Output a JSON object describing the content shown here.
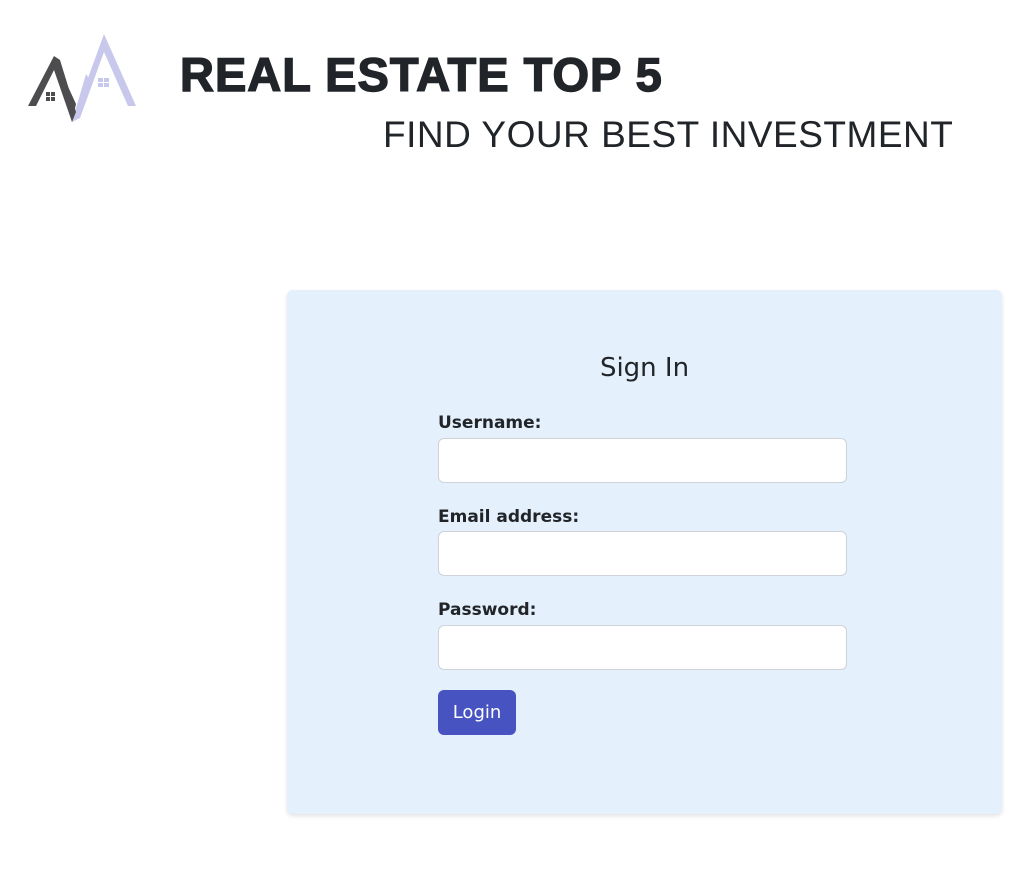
{
  "header": {
    "title": "REAL ESTATE TOP 5",
    "tagline": "FIND YOUR BEST INVESTMENT",
    "logo_icon": "house-roof-logo-icon"
  },
  "signin": {
    "title": "Sign In",
    "fields": [
      {
        "label": "Username:",
        "value": "",
        "placeholder": ""
      },
      {
        "label": "Email address:",
        "value": "",
        "placeholder": ""
      },
      {
        "label": "Password:",
        "value": "",
        "placeholder": ""
      }
    ],
    "login_label": "Login"
  },
  "colors": {
    "card_background": "#e4f0fb",
    "button_background": "#4653c1",
    "logo_dark": "#4d4d4f",
    "logo_light": "#c7c8ec",
    "text": "#212529"
  }
}
